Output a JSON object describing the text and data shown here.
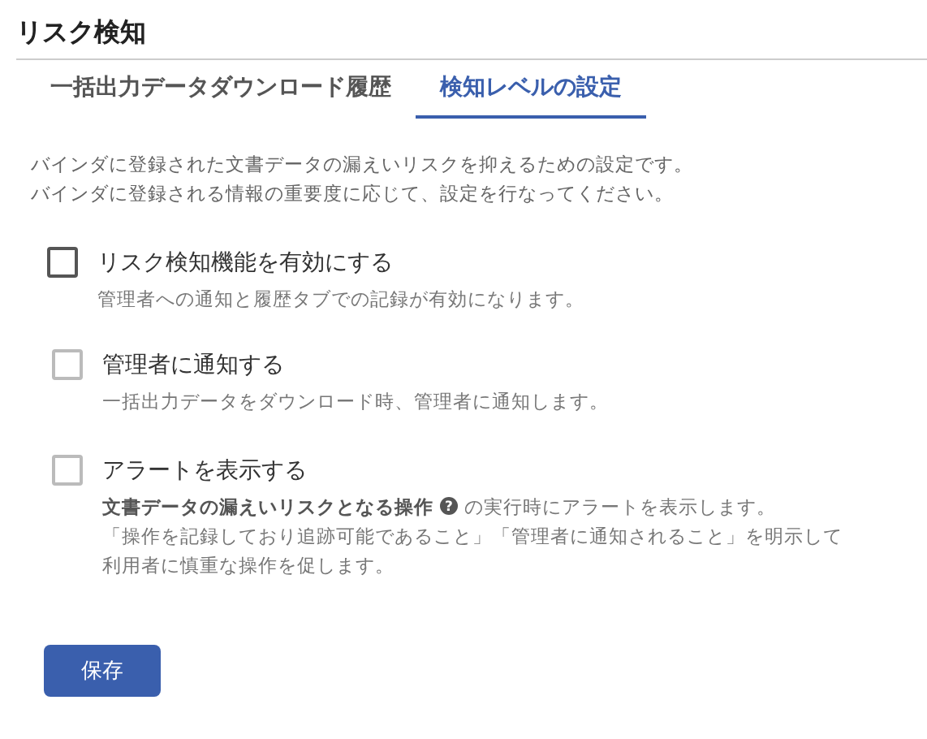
{
  "title": "リスク検知",
  "tabs": [
    {
      "label": "一括出力データダウンロード履歴",
      "selected": false
    },
    {
      "label": "検知レベルの設定",
      "selected": true
    }
  ],
  "intro": [
    "バインダに登録された文書データの漏えいリスクを抑えるための設定です。",
    "バインダに登録される情報の重要度に応じて、設定を行なってください。"
  ],
  "main_option": {
    "label": "リスク検知機能を有効にする",
    "checked": false,
    "disabled": false,
    "description": "管理者への通知と履歴タブでの記録が有効になります。"
  },
  "sub_options": [
    {
      "label": "管理者に通知する",
      "checked": false,
      "disabled": true,
      "description": "一括出力データをダウンロード時、管理者に通知します。"
    },
    {
      "label": "アラートを表示する",
      "checked": false,
      "disabled": true,
      "lead": "文書データの漏えいリスクとなる操作",
      "help": "?",
      "description": "の実行時にアラートを表示します。",
      "note": "「操作を記録しており追跡可能であること」「管理者に通知されること」を明示して利用者に慎重な操作を促します。"
    }
  ],
  "save_button": "保存"
}
